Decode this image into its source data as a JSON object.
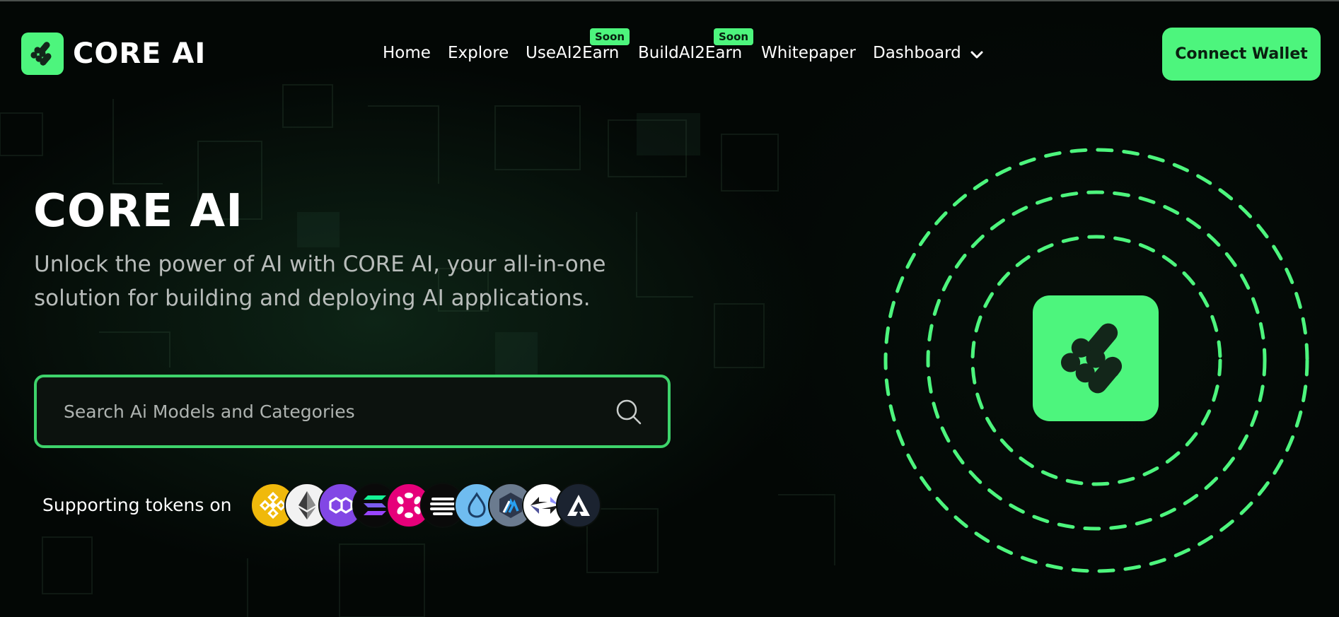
{
  "brand": {
    "name": "CORE AI",
    "accent": "#4df57d"
  },
  "nav": {
    "items": [
      {
        "label": "Home",
        "badge": null
      },
      {
        "label": "Explore",
        "badge": null
      },
      {
        "label": "UseAI2Earn",
        "badge": "Soon"
      },
      {
        "label": "BuildAI2Earn",
        "badge": "Soon"
      },
      {
        "label": "Whitepaper",
        "badge": null
      },
      {
        "label": "Dashboard",
        "badge": null,
        "icon": "chevron-down-icon"
      }
    ]
  },
  "header": {
    "connect_label": "Connect Wallet"
  },
  "hero": {
    "title": "CORE AI",
    "subtitle": "Unlock the power of AI with CORE AI, your all-in-one solution for building and deploying AI applications.",
    "search_placeholder": "Search Ai Models and Categories",
    "search_icon": "search-icon"
  },
  "tokens": {
    "label": "Supporting tokens on",
    "items": [
      {
        "name": "bnb-icon",
        "color": "#f0b90b"
      },
      {
        "name": "ethereum-icon",
        "color": "#f2f2f2"
      },
      {
        "name": "polygon-icon",
        "color": "#8247e5"
      },
      {
        "name": "solana-icon",
        "color": "#0a0a0a"
      },
      {
        "name": "polkadot-icon",
        "color": "#e6007a"
      },
      {
        "name": "aptos-icon",
        "color": "#0a0a0a"
      },
      {
        "name": "sui-icon",
        "color": "#6fbcf0"
      },
      {
        "name": "arbitrum-icon",
        "color": "#6b7b8f"
      },
      {
        "name": "zksync-icon",
        "color": "#ffffff"
      },
      {
        "name": "avalanche-icon",
        "color": "#1b2330"
      }
    ]
  }
}
